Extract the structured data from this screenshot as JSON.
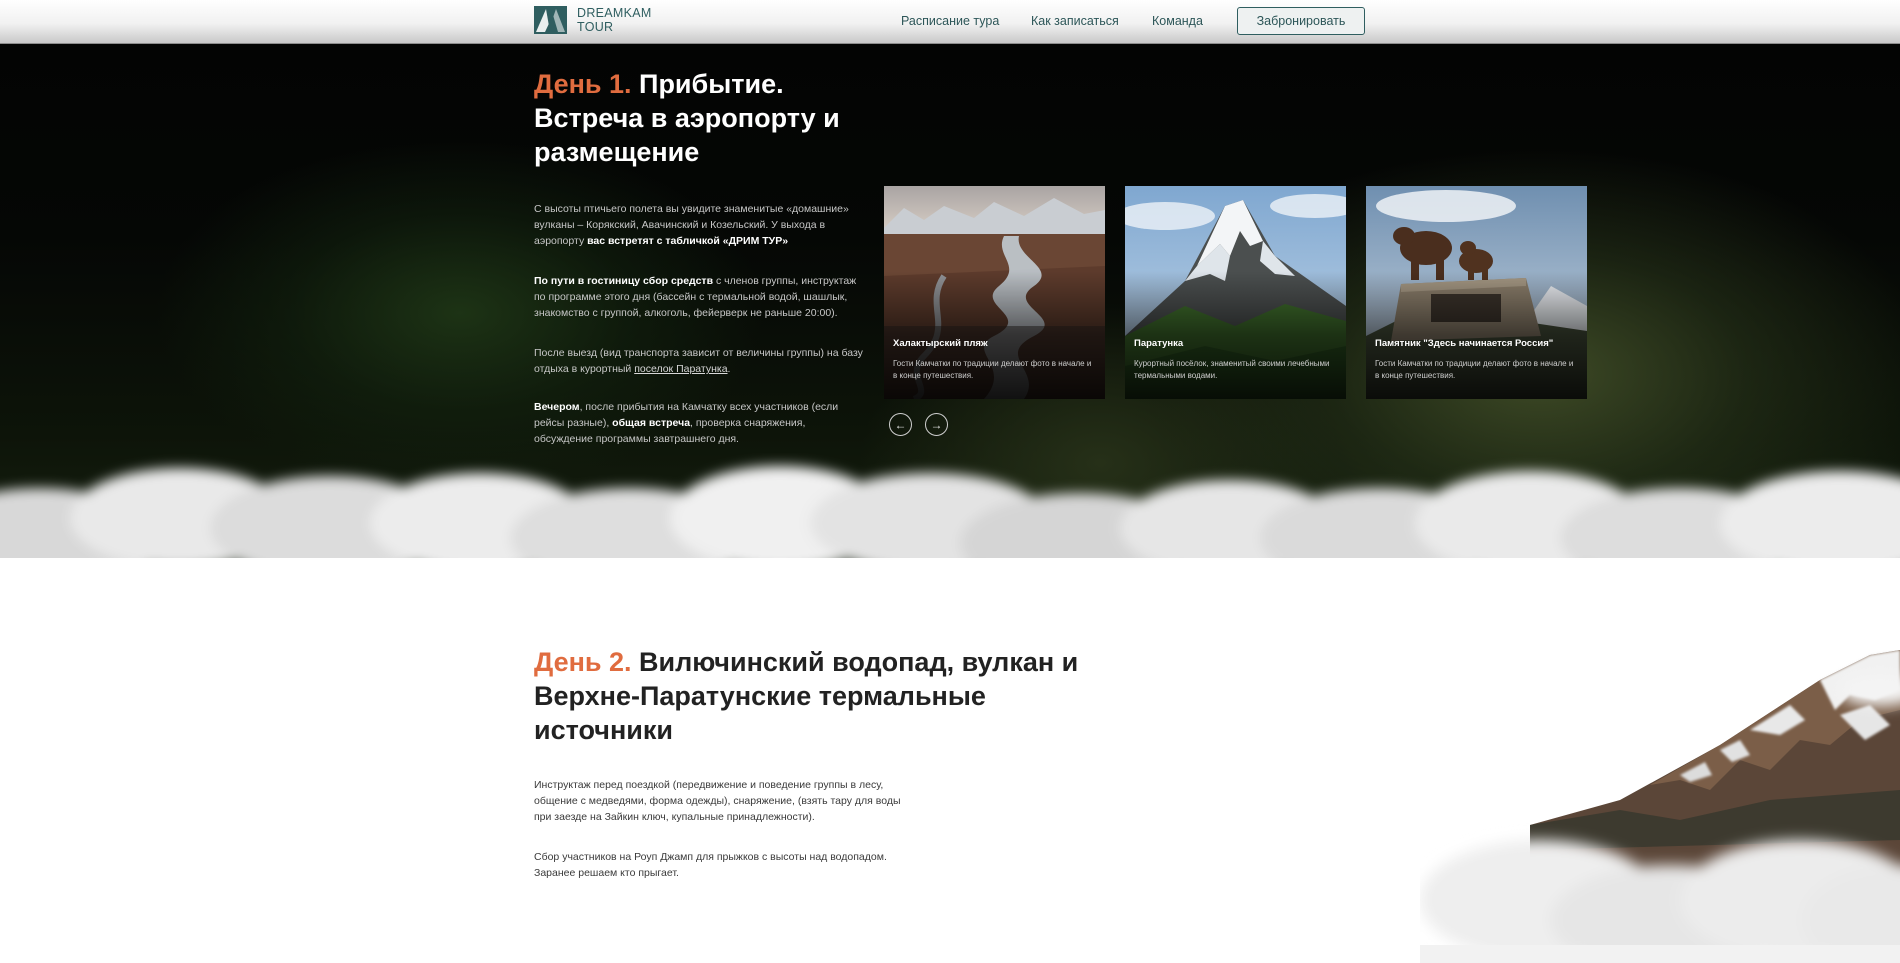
{
  "header": {
    "logo_line1": "DREAMKAM",
    "logo_line2": "TOUR",
    "nav": [
      "Расписание тура",
      "Как записаться",
      "Команда"
    ],
    "book_button": "Забронировать"
  },
  "day1": {
    "num": "День 1.",
    "title_line1": "Прибытие.",
    "title_line2": "Встреча в аэропорту и",
    "title_line3": "размещение",
    "p1_text": "С высоты птичьего полета вы увидите знаменитые «домашние» вулканы – Корякский, Авачинский и Козельский. У выхода в аэропорту ",
    "p1_bold": "вас встретят с табличкой «ДРИМ ТУР»",
    "p2_bold": "По пути в гостиницу сбор средств",
    "p2_text": " с членов группы, инструктаж по программе этого дня (бассейн с термальной водой, шашлык, знакомство с группой, алкоголь, фейерверк не раньше 20:00).",
    "p3_text": "После выезд (вид транспорта зависит от величины группы) на базу отдыха в курортный ",
    "p3_link": "поселок Паратунка",
    "p3_end": ".",
    "p4_bold1": "Вечером",
    "p4_text1": ", после прибытия на Камчатку всех участников (если рейсы разные), ",
    "p4_bold2": "общая встреча",
    "p4_text2": ", проверка снаряжения, обсуждение программы завтрашнего дня.",
    "cards": [
      {
        "title": "Халактырский пляж",
        "desc": "Гости Камчатки по традиции делают фото в начале и в конце путешествия."
      },
      {
        "title": "Паратунка",
        "desc": "Курортный посёлок, знаменитый своими лечебными термальными водами."
      },
      {
        "title": "Памятник \"Здесь начинается Россия\"",
        "desc": "Гости Камчатки по традиции делают фото в начале и в конце путешествия."
      }
    ],
    "prev_arrow": "←",
    "next_arrow": "→"
  },
  "day2": {
    "num": "День 2.",
    "title_line1": "Вилючинский водопад, вулкан и",
    "title_line2": "Верхне-Паратунские термальные",
    "title_line3": "источники",
    "p1": "Инструктаж перед поездкой (передвижение и поведение группы в лесу, общение с медведями, форма одежды), снаряжение, (взять тару для воды при заезде на Зайкин ключ, купальные принадлежности).",
    "p2": "Сбор участников на Роуп Джамп для прыжков с высоты над водопадом. Заранее решаем кто прыгает."
  },
  "colors": {
    "accent": "#e06c3f",
    "brand": "#2f5e60"
  }
}
